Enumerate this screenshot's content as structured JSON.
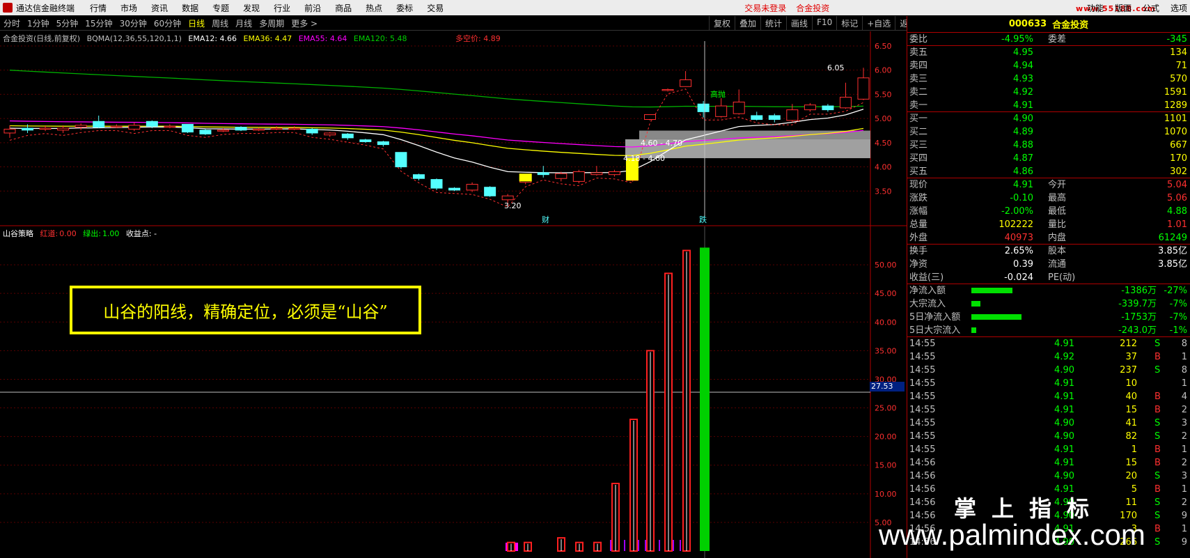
{
  "app": {
    "title": "通达信金融终端",
    "menu": [
      "行情",
      "市场",
      "资讯",
      "数据",
      "专题",
      "发现",
      "行业",
      "前沿",
      "商品",
      "热点",
      "委标",
      "交易"
    ],
    "alert_trade": "交易未登录",
    "alert_stock": "合金投资",
    "right_menu": [
      "功能",
      "版面",
      "公式",
      "选项"
    ],
    "watermark_top": "www.55188.com"
  },
  "periods": {
    "items": [
      "分时",
      "1分钟",
      "5分钟",
      "15分钟",
      "30分钟",
      "60分钟",
      "日线",
      "周线",
      "月线",
      "多周期",
      "更多 >"
    ],
    "active": "日线"
  },
  "toolbar": [
    "复权",
    "叠加",
    "统计",
    "画线",
    "F10",
    "标记",
    "+自选",
    "返回"
  ],
  "main_chart": {
    "legend": {
      "stock": "合金投资(日线,前复权)",
      "indicator": "BQMA(12,36,55,120,1,1)",
      "ema12": "EMA12: 4.66",
      "ema36": "EMA36: 4.47",
      "ema55": "EMA55: 4.64",
      "ema120": "EMA120: 5.48",
      "mid": "多空价: 4.89"
    },
    "y_ticks": [
      "6.50",
      "6.00",
      "5.50",
      "5.00",
      "4.50",
      "4.00",
      "3.50"
    ],
    "labels": {
      "high": "6.05",
      "low": "3.20",
      "zone1": "4.60 - 4.70",
      "zone2": "4.18 - 4.60",
      "tag_gaodian": "高抛",
      "marker_cai": "财",
      "marker_die": "跌"
    },
    "colors": {
      "up": "#ff3030",
      "down": "#54ffff",
      "ema12": "#ffffff",
      "ema36": "#ffff00",
      "ema55": "#ff00ff",
      "ema120": "#00b000"
    },
    "candles": [
      {
        "o": 4.7,
        "c": 4.78,
        "h": 4.86,
        "l": 4.6
      },
      {
        "o": 4.8,
        "c": 4.76,
        "h": 4.88,
        "l": 4.7
      },
      {
        "o": 4.8,
        "c": 4.8,
        "h": 4.86,
        "l": 4.74
      },
      {
        "o": 4.76,
        "c": 4.8,
        "h": 4.86,
        "l": 4.7
      },
      {
        "o": 4.82,
        "c": 4.86,
        "h": 4.9,
        "l": 4.76
      },
      {
        "o": 4.94,
        "c": 4.82,
        "h": 5.06,
        "l": 4.8
      },
      {
        "o": 4.84,
        "c": 4.84,
        "h": 4.88,
        "l": 4.8
      },
      {
        "o": 4.78,
        "c": 4.86,
        "h": 4.92,
        "l": 4.74
      },
      {
        "o": 4.94,
        "c": 4.84,
        "h": 4.96,
        "l": 4.8
      },
      {
        "o": 4.84,
        "c": 4.84,
        "h": 4.88,
        "l": 4.8
      },
      {
        "o": 4.88,
        "c": 4.72,
        "h": 4.88,
        "l": 4.7
      },
      {
        "o": 4.76,
        "c": 4.68,
        "h": 4.78,
        "l": 4.66
      },
      {
        "o": 4.76,
        "c": 4.76,
        "h": 4.8,
        "l": 4.72
      },
      {
        "o": 4.82,
        "c": 4.76,
        "h": 4.84,
        "l": 4.74
      },
      {
        "o": 4.78,
        "c": 4.78,
        "h": 4.82,
        "l": 4.74
      },
      {
        "o": 4.8,
        "c": 4.8,
        "h": 4.84,
        "l": 4.76
      },
      {
        "o": 4.8,
        "c": 4.8,
        "h": 4.84,
        "l": 4.76
      },
      {
        "o": 4.78,
        "c": 4.7,
        "h": 4.8,
        "l": 4.66
      },
      {
        "o": 4.66,
        "c": 4.7,
        "h": 4.72,
        "l": 4.62
      },
      {
        "o": 4.68,
        "c": 4.6,
        "h": 4.7,
        "l": 4.56
      },
      {
        "o": 4.56,
        "c": 4.52,
        "h": 4.58,
        "l": 4.5
      },
      {
        "o": 4.52,
        "c": 4.46,
        "h": 4.54,
        "l": 4.42
      },
      {
        "o": 4.3,
        "c": 4.0,
        "h": 4.3,
        "l": 3.96
      },
      {
        "o": 3.84,
        "c": 3.76,
        "h": 3.86,
        "l": 3.72
      },
      {
        "o": 3.74,
        "c": 3.56,
        "h": 3.76,
        "l": 3.52
      },
      {
        "o": 3.56,
        "c": 3.52,
        "h": 3.58,
        "l": 3.5
      },
      {
        "o": 3.52,
        "c": 3.64,
        "h": 3.68,
        "l": 3.48
      },
      {
        "o": 3.58,
        "c": 3.4,
        "h": 3.6,
        "l": 3.38
      },
      {
        "o": 3.32,
        "c": 3.4,
        "h": 3.44,
        "l": 3.22
      },
      {
        "o": 3.68,
        "c": 3.82,
        "h": 3.84,
        "l": 3.64
      },
      {
        "o": 3.88,
        "c": 3.84,
        "h": 4.02,
        "l": 3.78
      },
      {
        "o": 3.76,
        "c": 3.86,
        "h": 3.9,
        "l": 3.7
      },
      {
        "o": 3.7,
        "c": 3.9,
        "h": 3.94,
        "l": 3.66
      },
      {
        "o": 3.84,
        "c": 3.88,
        "h": 4.02,
        "l": 3.82
      },
      {
        "o": 3.84,
        "c": 3.9,
        "h": 3.94,
        "l": 3.8
      },
      {
        "o": 3.72,
        "c": 4.16,
        "h": 4.18,
        "l": 3.72
      },
      {
        "o": 4.98,
        "c": 5.08,
        "h": 5.08,
        "l": 4.96
      },
      {
        "o": 5.58,
        "c": 5.6,
        "h": 5.62,
        "l": 5.56
      },
      {
        "o": 5.66,
        "c": 5.8,
        "h": 5.98,
        "l": 5.66
      },
      {
        "o": 5.3,
        "c": 5.14,
        "h": 5.36,
        "l": 5.02
      },
      {
        "o": 5.04,
        "c": 5.26,
        "h": 5.42,
        "l": 5.02
      },
      {
        "o": 5.1,
        "c": 5.34,
        "h": 5.6,
        "l": 5.08
      },
      {
        "o": 5.06,
        "c": 4.98,
        "h": 5.14,
        "l": 4.96
      },
      {
        "o": 5.06,
        "c": 4.98,
        "h": 5.1,
        "l": 4.92
      },
      {
        "o": 4.96,
        "c": 5.18,
        "h": 5.3,
        "l": 4.92
      },
      {
        "o": 5.18,
        "c": 5.28,
        "h": 5.32,
        "l": 5.14
      },
      {
        "o": 5.26,
        "c": 5.18,
        "h": 5.3,
        "l": 5.14
      },
      {
        "o": 5.22,
        "c": 5.44,
        "h": 5.74,
        "l": 5.2
      },
      {
        "o": 5.4,
        "c": 5.84,
        "h": 6.05,
        "l": 5.38
      }
    ]
  },
  "indicator_chart": {
    "legend": {
      "name": "山谷策略",
      "red_label": "红道:",
      "red_value": "0.00",
      "green_label": "绿出:",
      "green_value": "1.00",
      "profit_label": "收益点: -"
    },
    "y_ticks": [
      "50.00",
      "45.00",
      "40.00",
      "35.00",
      "30.00",
      "25.00",
      "20.00",
      "15.00",
      "10.00",
      "5.00"
    ],
    "y_max": 55,
    "cursor_value": "27.53",
    "bars": [
      {
        "value": 1.5,
        "color": "red"
      },
      {
        "value": 1.5,
        "color": "red"
      },
      {
        "value": 2.3,
        "color": "red"
      },
      {
        "value": 1.5,
        "color": "red"
      },
      {
        "value": 1.5,
        "color": "red"
      },
      {
        "value": 11.8,
        "color": "red"
      },
      {
        "value": 23.0,
        "color": "red"
      },
      {
        "value": 35.0,
        "color": "red"
      },
      {
        "value": 48.5,
        "color": "red"
      },
      {
        "value": 52.5,
        "color": "red"
      },
      {
        "value": 53.0,
        "color": "green"
      }
    ],
    "annotation": "山谷的阳线，精确定位，必须是“山谷”"
  },
  "quote": {
    "code": "000633",
    "name": "合金投资",
    "wei": {
      "label1": "委比",
      "v1": "-4.95%",
      "label2": "委差",
      "v2": "-345"
    },
    "asks": [
      {
        "label": "卖五",
        "price": "4.95",
        "vol": "134"
      },
      {
        "label": "卖四",
        "price": "4.94",
        "vol": "71"
      },
      {
        "label": "卖三",
        "price": "4.93",
        "vol": "570"
      },
      {
        "label": "卖二",
        "price": "4.92",
        "vol": "1591"
      },
      {
        "label": "卖一",
        "price": "4.91",
        "vol": "1289"
      }
    ],
    "bids": [
      {
        "label": "买一",
        "price": "4.90",
        "vol": "1101"
      },
      {
        "label": "买二",
        "price": "4.89",
        "vol": "1070"
      },
      {
        "label": "买三",
        "price": "4.88",
        "vol": "667"
      },
      {
        "label": "买四",
        "price": "4.87",
        "vol": "170"
      },
      {
        "label": "买五",
        "price": "4.86",
        "vol": "302"
      }
    ],
    "stats": [
      {
        "l1": "现价",
        "v1": "4.91",
        "c1": "green",
        "l2": "今开",
        "v2": "5.04",
        "c2": "red"
      },
      {
        "l1": "涨跌",
        "v1": "-0.10",
        "c1": "green",
        "l2": "最高",
        "v2": "5.06",
        "c2": "red"
      },
      {
        "l1": "涨幅",
        "v1": "-2.00%",
        "c1": "green",
        "l2": "最低",
        "v2": "4.88",
        "c2": "green"
      },
      {
        "l1": "总量",
        "v1": "102222",
        "c1": "yellow",
        "l2": "量比",
        "v2": "1.01",
        "c2": "red"
      },
      {
        "l1": "外盘",
        "v1": "40973",
        "c1": "red",
        "l2": "内盘",
        "v2": "61249",
        "c2": "green"
      }
    ],
    "fundamentals": [
      {
        "l1": "换手",
        "v1": "2.65%",
        "l2": "股本",
        "v2": "3.85亿"
      },
      {
        "l1": "净资",
        "v1": "0.39",
        "l2": "流通",
        "v2": "3.85亿"
      },
      {
        "l1": "收益(三)",
        "v1": "-0.024",
        "l2": "PE(动)",
        "v2": ""
      }
    ],
    "flows": [
      {
        "label": "净流入额",
        "bar": 0.45,
        "v1": "-1386万",
        "v2": "-27%"
      },
      {
        "label": "大宗流入",
        "bar": 0.1,
        "v1": "-339.7万",
        "v2": "-7%"
      },
      {
        "label": "5日净流入额",
        "bar": 0.55,
        "v1": "-1753万",
        "v2": "-7%"
      },
      {
        "label": "5日大宗流入",
        "bar": 0.05,
        "v1": "-243.0万",
        "v2": "-1%"
      }
    ],
    "ticks": [
      {
        "t": "14:55",
        "p": "4.91",
        "pc": "green",
        "v": "212",
        "bs": "S",
        "n": "8"
      },
      {
        "t": "14:55",
        "p": "4.92",
        "pc": "green",
        "v": "37",
        "bs": "B",
        "n": "1"
      },
      {
        "t": "14:55",
        "p": "4.90",
        "pc": "green",
        "v": "237",
        "bs": "S",
        "n": "8"
      },
      {
        "t": "14:55",
        "p": "4.91",
        "pc": "green",
        "v": "10",
        "bs": "",
        "n": "1"
      },
      {
        "t": "14:55",
        "p": "4.91",
        "pc": "green",
        "v": "40",
        "bs": "B",
        "n": "4"
      },
      {
        "t": "14:55",
        "p": "4.91",
        "pc": "green",
        "v": "15",
        "bs": "B",
        "n": "2"
      },
      {
        "t": "14:55",
        "p": "4.90",
        "pc": "green",
        "v": "41",
        "bs": "S",
        "n": "3"
      },
      {
        "t": "14:55",
        "p": "4.90",
        "pc": "green",
        "v": "82",
        "bs": "S",
        "n": "2"
      },
      {
        "t": "14:55",
        "p": "4.91",
        "pc": "green",
        "v": "1",
        "bs": "B",
        "n": "1"
      },
      {
        "t": "14:56",
        "p": "4.91",
        "pc": "green",
        "v": "15",
        "bs": "B",
        "n": "2"
      },
      {
        "t": "14:56",
        "p": "4.90",
        "pc": "green",
        "v": "20",
        "bs": "S",
        "n": "3"
      },
      {
        "t": "14:56",
        "p": "4.91",
        "pc": "green",
        "v": "5",
        "bs": "B",
        "n": "1"
      },
      {
        "t": "14:56",
        "p": "4.90",
        "pc": "green",
        "v": "11",
        "bs": "S",
        "n": "2"
      },
      {
        "t": "14:56",
        "p": "4.90",
        "pc": "green",
        "v": "170",
        "bs": "S",
        "n": "9"
      },
      {
        "t": "14:56",
        "p": "4.91",
        "pc": "green",
        "v": "3",
        "bs": "B",
        "n": "1"
      },
      {
        "t": "14:56",
        "p": "4.90",
        "pc": "green",
        "v": "266",
        "bs": "S",
        "n": "9"
      }
    ]
  },
  "watermark": {
    "cn": "掌上指标",
    "url": "www.palmindex.com"
  }
}
